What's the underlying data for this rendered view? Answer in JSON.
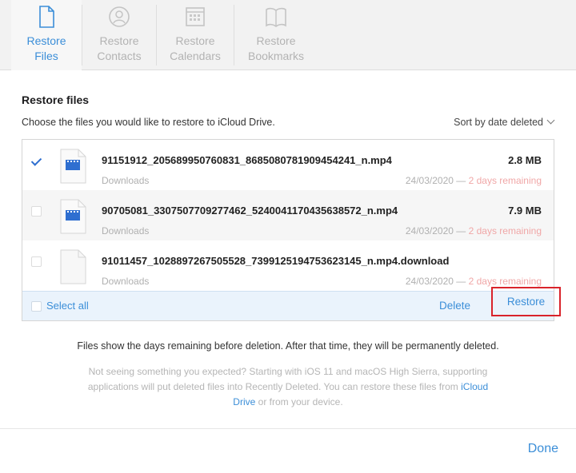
{
  "tabs": [
    {
      "label": "Restore\nFiles",
      "icon": "file-icon",
      "active": true
    },
    {
      "label": "Restore\nContacts",
      "icon": "contacts-icon",
      "active": false
    },
    {
      "label": "Restore\nCalendars",
      "icon": "calendar-icon",
      "active": false
    },
    {
      "label": "Restore\nBookmarks",
      "icon": "bookmarks-icon",
      "active": false
    }
  ],
  "section": {
    "title": "Restore files",
    "subtitle": "Choose the files you would like to restore to iCloud Drive.",
    "sort_label": "Sort by date deleted"
  },
  "files": [
    {
      "name": "91151912_205689950760831_8685080781909454241_n.mp4",
      "size": "2.8 MB",
      "location": "Downloads",
      "date": "24/03/2020",
      "remaining": "2 days remaining",
      "checked": true,
      "type": "video"
    },
    {
      "name": "90705081_3307507709277462_5240041170435638572_n.mp4",
      "size": "7.9 MB",
      "location": "Downloads",
      "date": "24/03/2020",
      "remaining": "2 days remaining",
      "checked": false,
      "type": "video"
    },
    {
      "name": "91011457_1028897267505528_7399125194753623145_n.mp4.download",
      "size": "",
      "location": "Downloads",
      "date": "24/03/2020",
      "remaining": "2 days remaining",
      "checked": false,
      "type": "generic"
    }
  ],
  "date_separator": "—",
  "actions": {
    "select_all": "Select all",
    "delete": "Delete",
    "restore": "Restore"
  },
  "notes": {
    "deletion_info": "Files show the days remaining before deletion. After that time, they will be permanently deleted.",
    "help_line1": "Not seeing something you expected? Starting with iOS 11 and macOS High Sierra, supporting",
    "help_line2": "applications will put deleted files into Recently Deleted. You can restore these files from",
    "help_link_a": "iCloud",
    "help_link_b": "Drive",
    "help_line3_rest": "or from your device."
  },
  "done_label": "Done",
  "colors": {
    "accent": "#3b8ed8",
    "highlight_border": "#d9232b",
    "remaining_text": "#f0a7a7"
  }
}
